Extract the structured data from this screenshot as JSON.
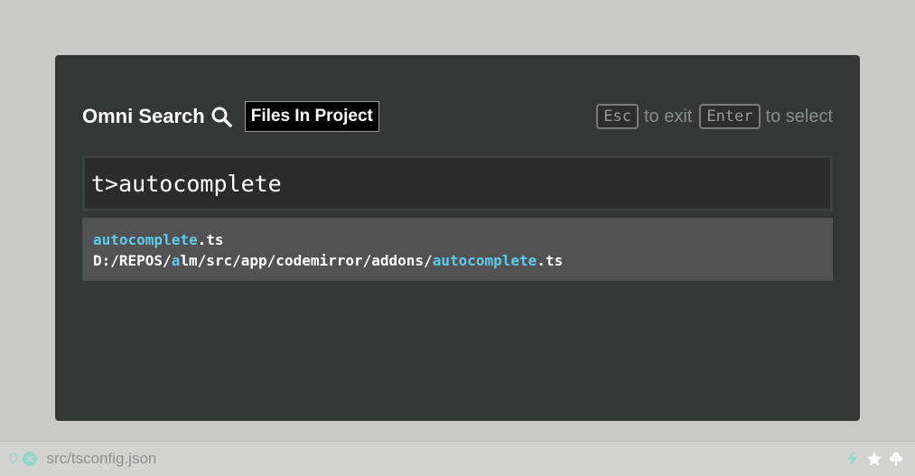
{
  "modal": {
    "title": "Omni Search",
    "mode": "Files In Project",
    "hints": {
      "esc_key": "Esc",
      "esc_text": "to exit",
      "enter_key": "Enter",
      "enter_text": "to select"
    },
    "search": {
      "value": "t>autocomplete"
    },
    "results": [
      {
        "name_match": "autocomplete",
        "name_rest": ".ts",
        "path_parts": [
          "D:/REPOS/",
          "a",
          "lm/src/app/codemirror/addons/",
          "autocomplete",
          ".ts"
        ]
      }
    ]
  },
  "statusbar": {
    "count": "0",
    "file": "src/tsconfig.json"
  },
  "colors": {
    "accent": "#5ecbec",
    "status_count": "#8fd8cc"
  }
}
